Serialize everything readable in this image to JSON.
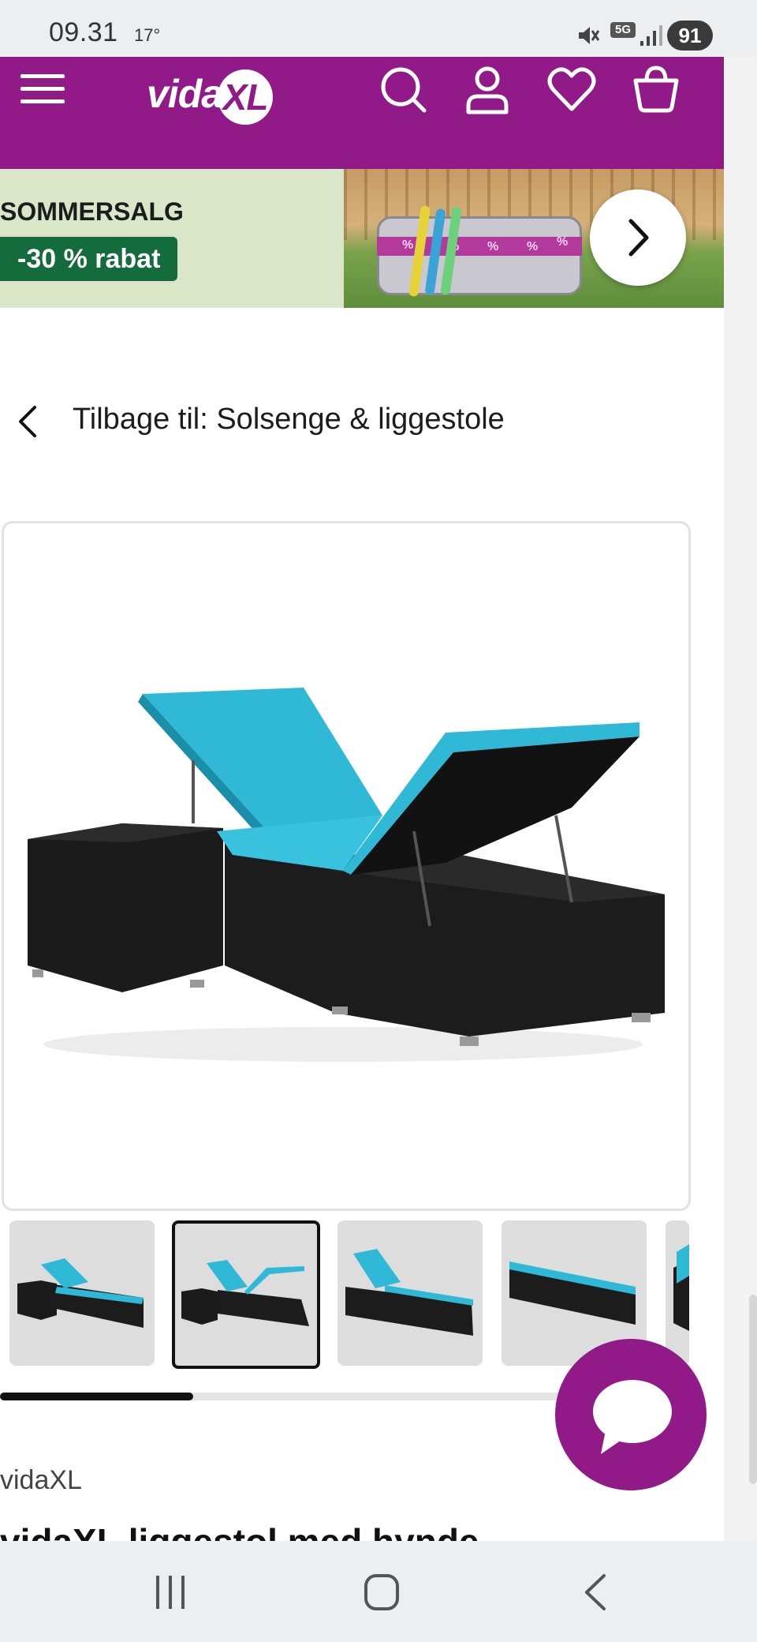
{
  "status_bar": {
    "time": "09.31",
    "temperature": "17°",
    "network": "5G",
    "battery": "91"
  },
  "header": {
    "brand_prefix": "vida",
    "brand_suffix": "XL",
    "icons": [
      "menu-icon",
      "search-icon",
      "account-icon",
      "wishlist-icon",
      "cart-icon"
    ],
    "accent_color": "#921a88"
  },
  "banner": {
    "title": "SOMMERSALG",
    "badge": "-30 % rabat",
    "pool_marks": [
      "%",
      "%",
      "%",
      "%",
      "%"
    ]
  },
  "breadcrumb": {
    "back_label": "Tilbage til: Solsenge & liggestole"
  },
  "gallery": {
    "thumbnail_count": 5,
    "selected_index": 1,
    "scroll_progress": 0.34
  },
  "product": {
    "brand": "vidaXL",
    "title": "vidaXL liggestol med hynde"
  },
  "colors": {
    "cushion": "#2fb9d6",
    "rattan": "#1b1b1b",
    "badge_green": "#146b3b"
  }
}
